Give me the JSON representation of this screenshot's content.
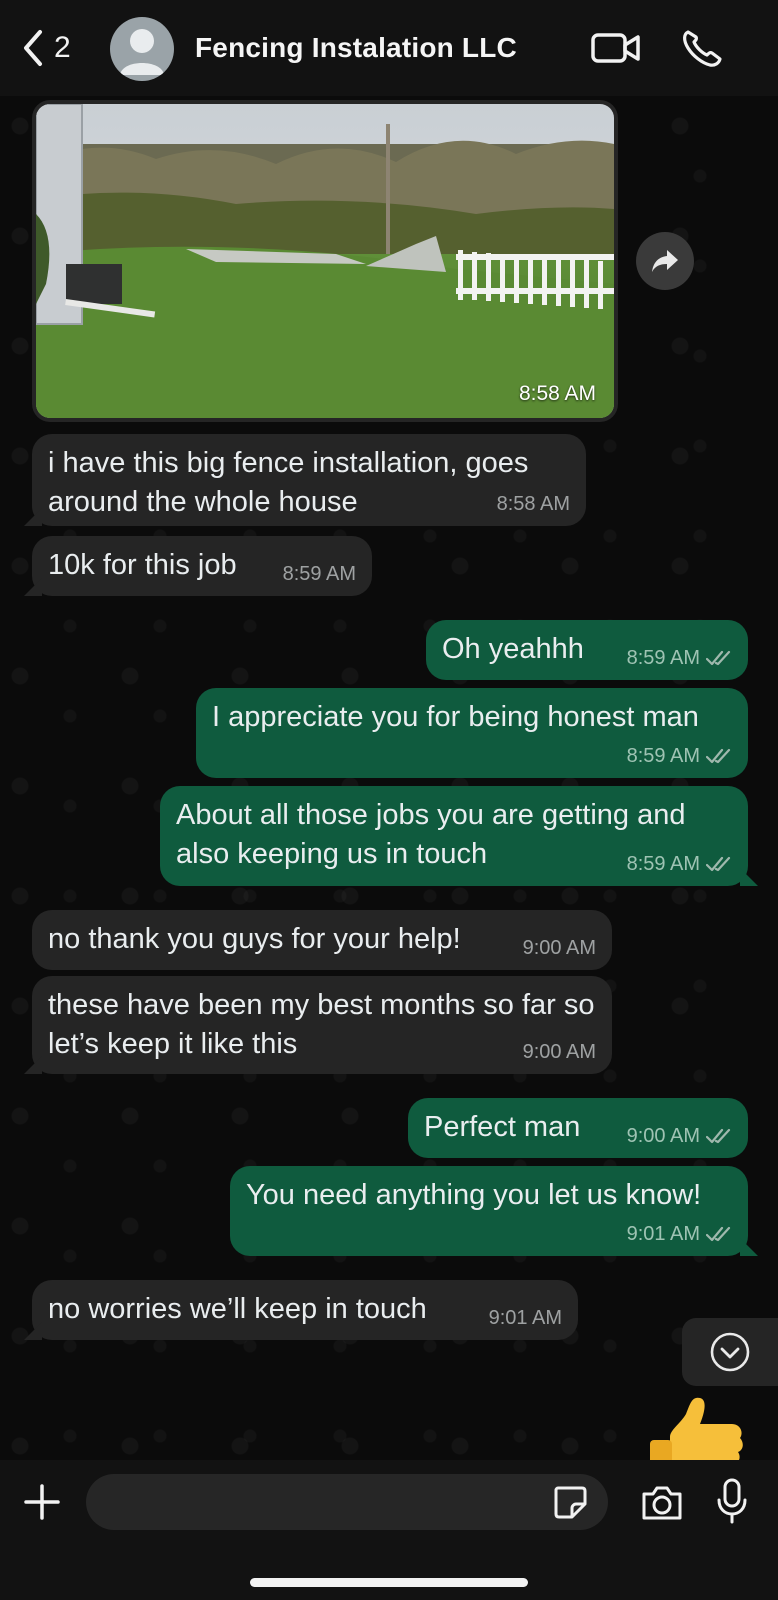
{
  "header": {
    "back_count": "2",
    "contact_name": "Fencing Instalation LLC",
    "icons": [
      "chevron-left-icon",
      "avatar",
      "video-call-icon",
      "phone-icon"
    ]
  },
  "chat": {
    "image_message": {
      "time": "8:58 AM"
    },
    "messages": [
      {
        "dir": "in",
        "text": "i have this big fence installation, goes around the whole house",
        "time": "8:58 AM"
      },
      {
        "dir": "in",
        "text": "10k for this job",
        "time": "8:59 AM"
      },
      {
        "dir": "out",
        "text": "Oh yeahhh",
        "time": "8:59 AM"
      },
      {
        "dir": "out",
        "text": "I appreciate you for being honest man",
        "time": "8:59 AM"
      },
      {
        "dir": "out",
        "text": "About all those jobs you are getting and also keeping us in touch",
        "time": "8:59 AM"
      },
      {
        "dir": "in",
        "text": "no thank you guys for your help!",
        "time": "9:00 AM"
      },
      {
        "dir": "in",
        "text": "these have been my best months so far so let’s keep it like this",
        "time": "9:00 AM"
      },
      {
        "dir": "out",
        "text": "Perfect man",
        "time": "9:00 AM"
      },
      {
        "dir": "out",
        "text": "You need anything you let us know!",
        "time": "9:01 AM"
      },
      {
        "dir": "in",
        "text": "no worries we’ll keep in touch",
        "time": "9:01 AM"
      }
    ]
  },
  "composer": {
    "placeholder": "",
    "icons": [
      "plus-icon",
      "sticker-icon",
      "camera-icon",
      "microphone-icon"
    ]
  },
  "colors": {
    "incoming_bubble": "#252525",
    "outgoing_bubble": "#0f5b3e",
    "read_ticks": "#9fb8ad"
  }
}
